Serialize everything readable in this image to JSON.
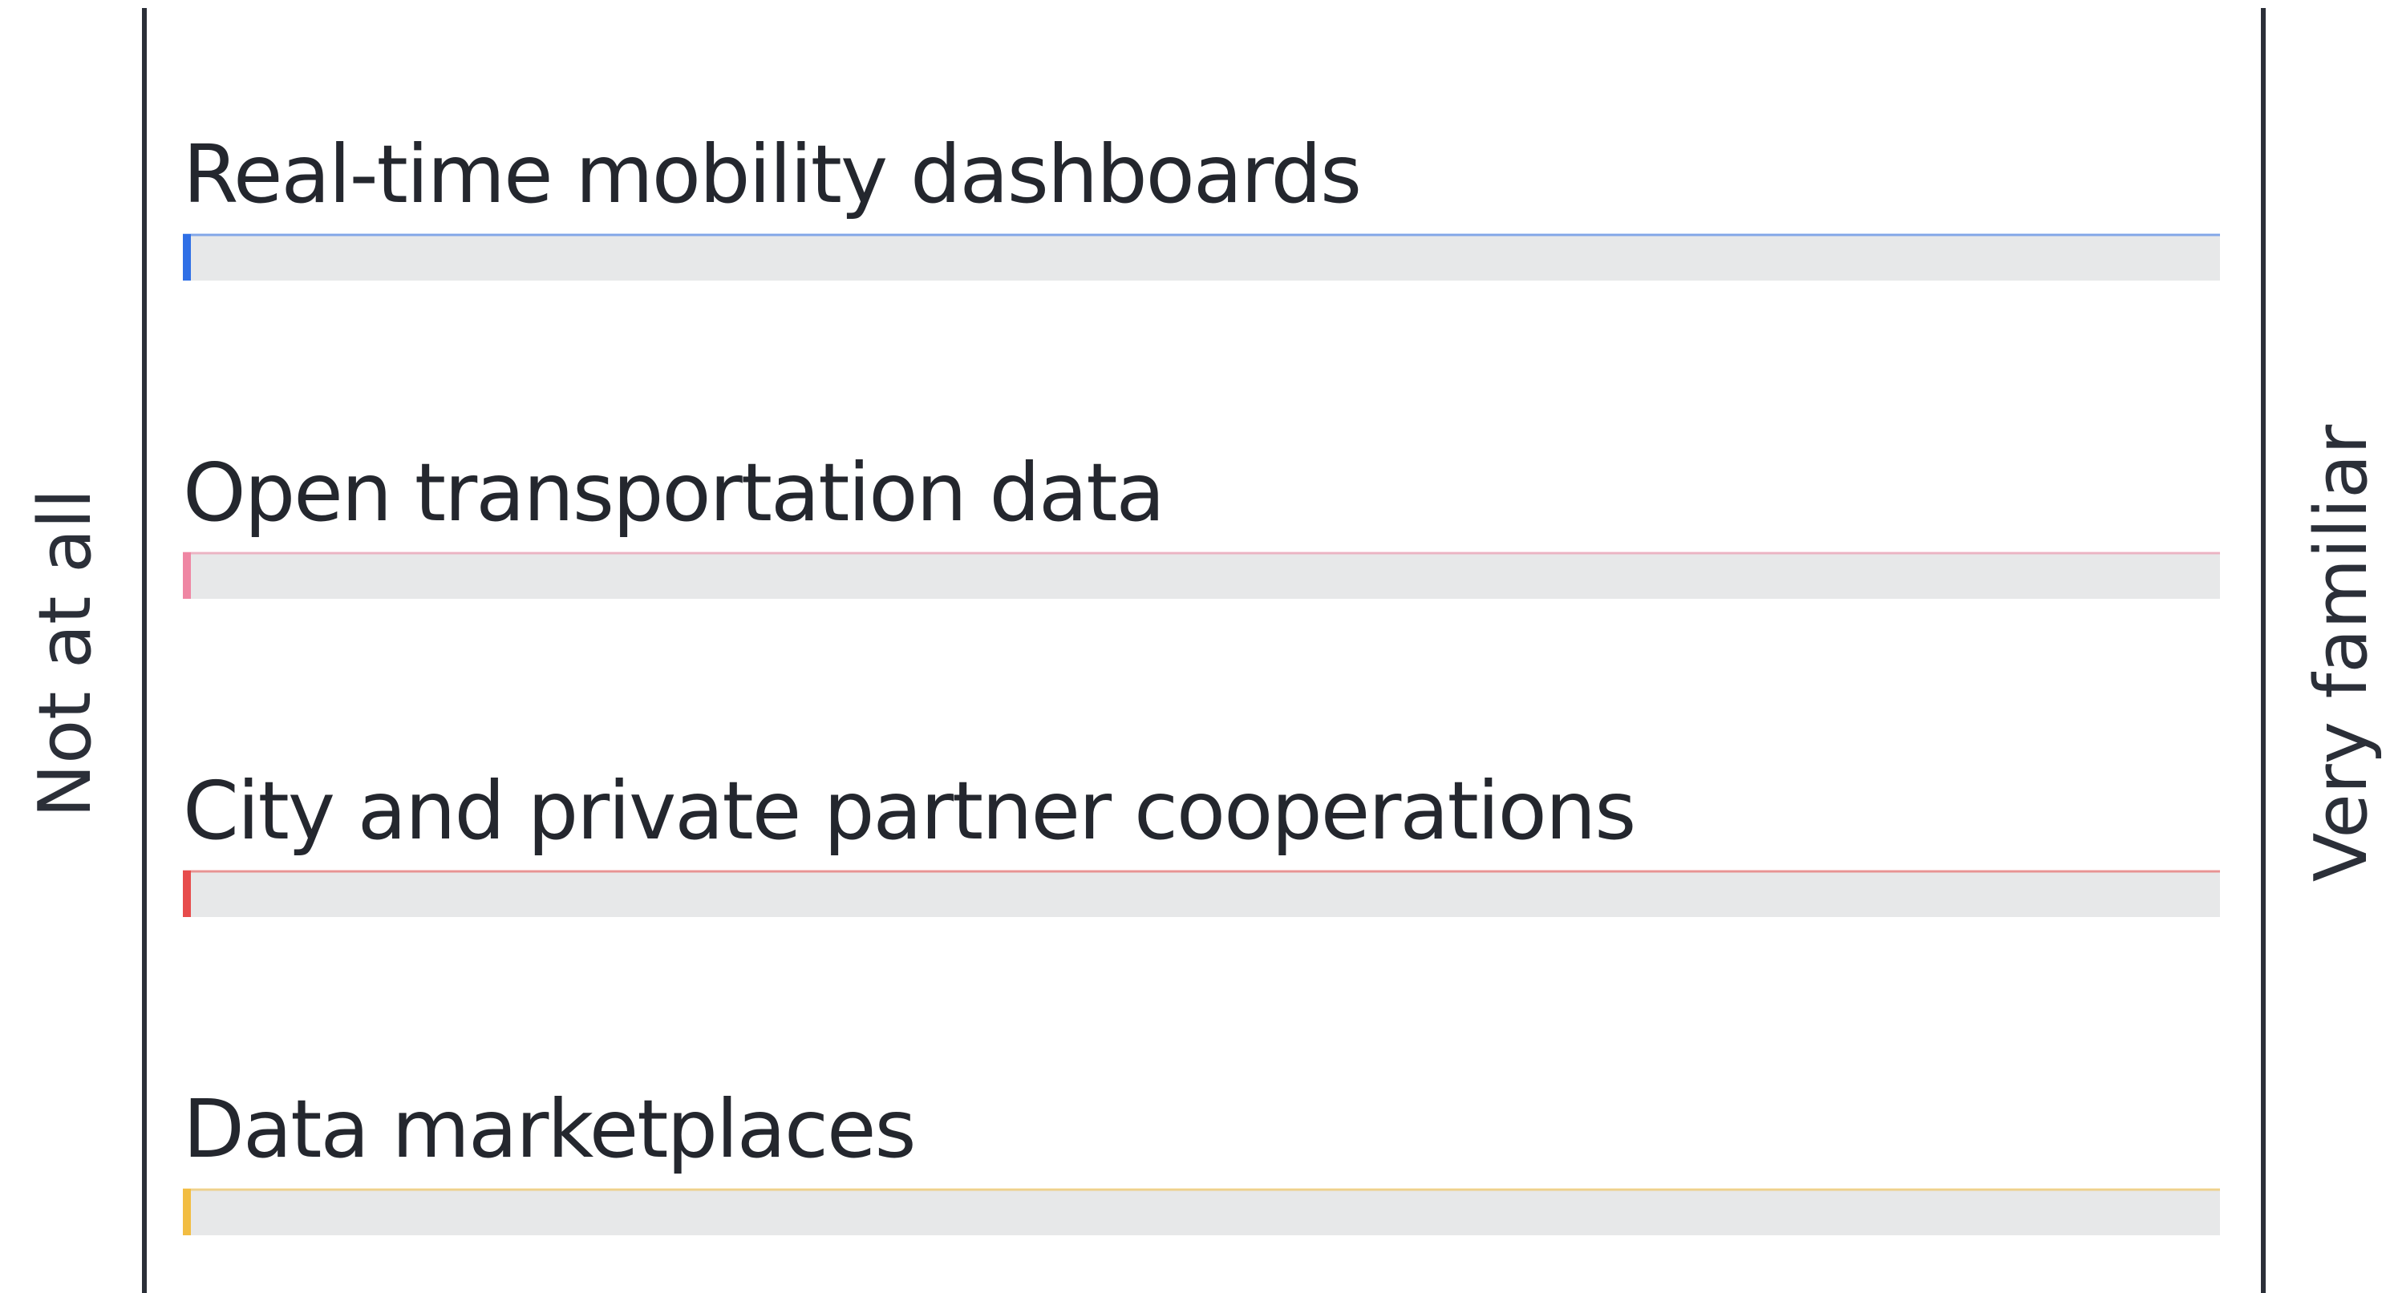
{
  "chart_data": {
    "type": "bar",
    "orientation": "horizontal",
    "scale_min_label": "Not at all",
    "scale_max_label": "Very familiar",
    "xlim": [
      0,
      1
    ],
    "grid": false,
    "categories": [
      "Real-time mobility dashboards",
      "Open transportation data",
      "City and private partner cooperations",
      "Data marketplaces"
    ],
    "values": [
      0,
      0,
      0,
      0
    ],
    "colors": [
      "#2f6fe6",
      "#ef86a3",
      "#e74c4c",
      "#f2bd42"
    ],
    "track_color": "#e7e8e9"
  }
}
